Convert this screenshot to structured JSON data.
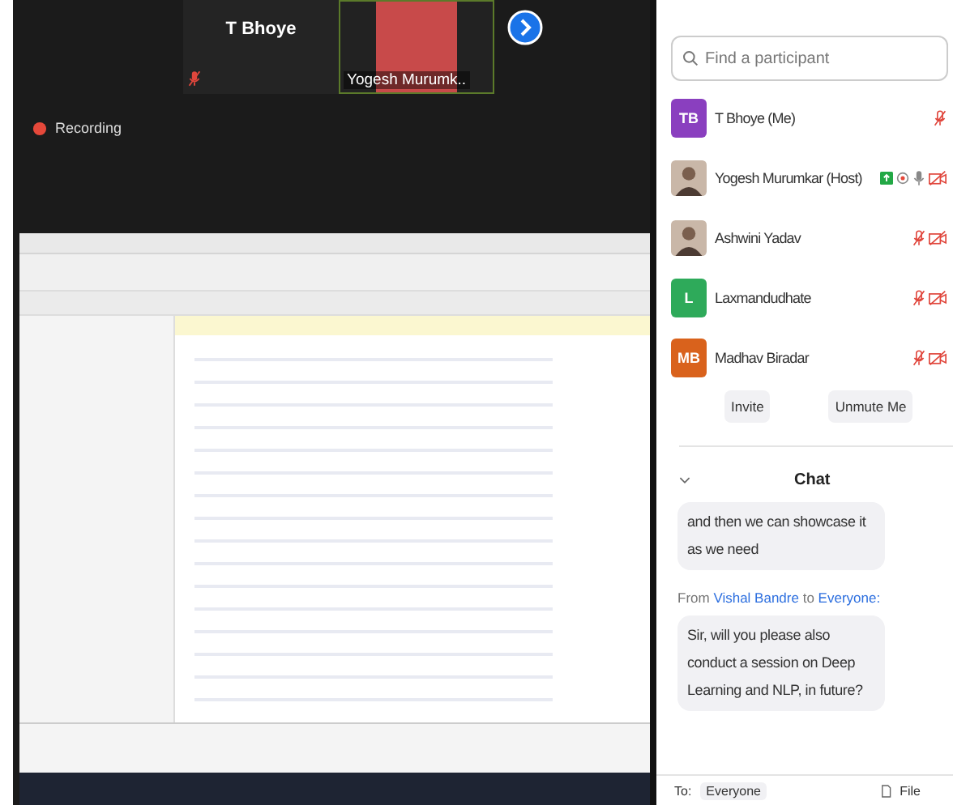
{
  "video_strip": {
    "tiles": [
      {
        "kind": "name",
        "name": "T Bhoye",
        "muted": true
      },
      {
        "kind": "video",
        "name": "Yogesh Murumk.."
      }
    ]
  },
  "recording": {
    "label": "Recording"
  },
  "participants": {
    "search": {
      "placeholder": "Find a participant"
    },
    "items": [
      {
        "kind": "initials",
        "initials": "TB",
        "color": "#8a3fbf",
        "name": "T Bhoye (Me)",
        "mic_muted": true,
        "video_off": false
      },
      {
        "kind": "photo",
        "name": "Yogesh Murumkar (Host)",
        "mic_muted": false,
        "video_off": true,
        "status_icons": [
          {
            "kind": "share"
          },
          {
            "kind": "record"
          }
        ]
      },
      {
        "kind": "photo",
        "name": "Ashwini Yadav",
        "mic_muted": true,
        "video_off": true
      },
      {
        "kind": "initials",
        "initials": "L",
        "color": "#2eaa5a",
        "name": "Laxmandudhate",
        "mic_muted": true,
        "video_off": true
      },
      {
        "kind": "initials",
        "initials": "MB",
        "color": "#d9621c",
        "name": "Madhav Biradar",
        "mic_muted": true,
        "video_off": true
      }
    ],
    "buttons": [
      "Invite",
      "Unmute Me"
    ]
  },
  "chat": {
    "title": "Chat",
    "messages": [
      {
        "text": "and then we can showcase it as we need"
      },
      {
        "prefix": "From",
        "sender": "Vishal Bandre",
        "joiner": "to",
        "recipient": "Everyone:",
        "text": "Sir, will you please also conduct a session on Deep Learning and NLP, in future?"
      }
    ],
    "composer": {
      "to_label": "To:",
      "recipient": "Everyone",
      "file_label": "File"
    }
  }
}
